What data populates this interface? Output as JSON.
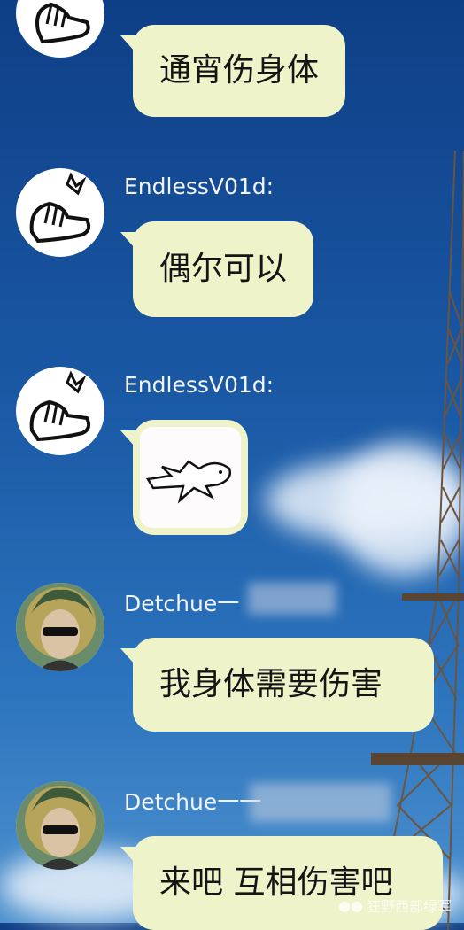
{
  "messages": [
    {
      "sender": "",
      "text": "通宵伤身体",
      "avatar": "cartoon-avatar"
    },
    {
      "sender": "EndlessV01d:",
      "text": "偶尔可以",
      "avatar": "cartoon-avatar"
    },
    {
      "sender": "EndlessV01d:",
      "text": "",
      "avatar": "cartoon-avatar",
      "image": "sticker"
    },
    {
      "sender": "Detchue一",
      "text": "我身体需要伤害",
      "avatar": "portrait-avatar"
    },
    {
      "sender": "Detchue一一",
      "text": "来吧 互相伤害吧",
      "avatar": "portrait-avatar"
    }
  ],
  "watermark": "狂野西部绿军",
  "colors": {
    "bubble": "#eef3c9",
    "background": "#1b5aa6"
  }
}
